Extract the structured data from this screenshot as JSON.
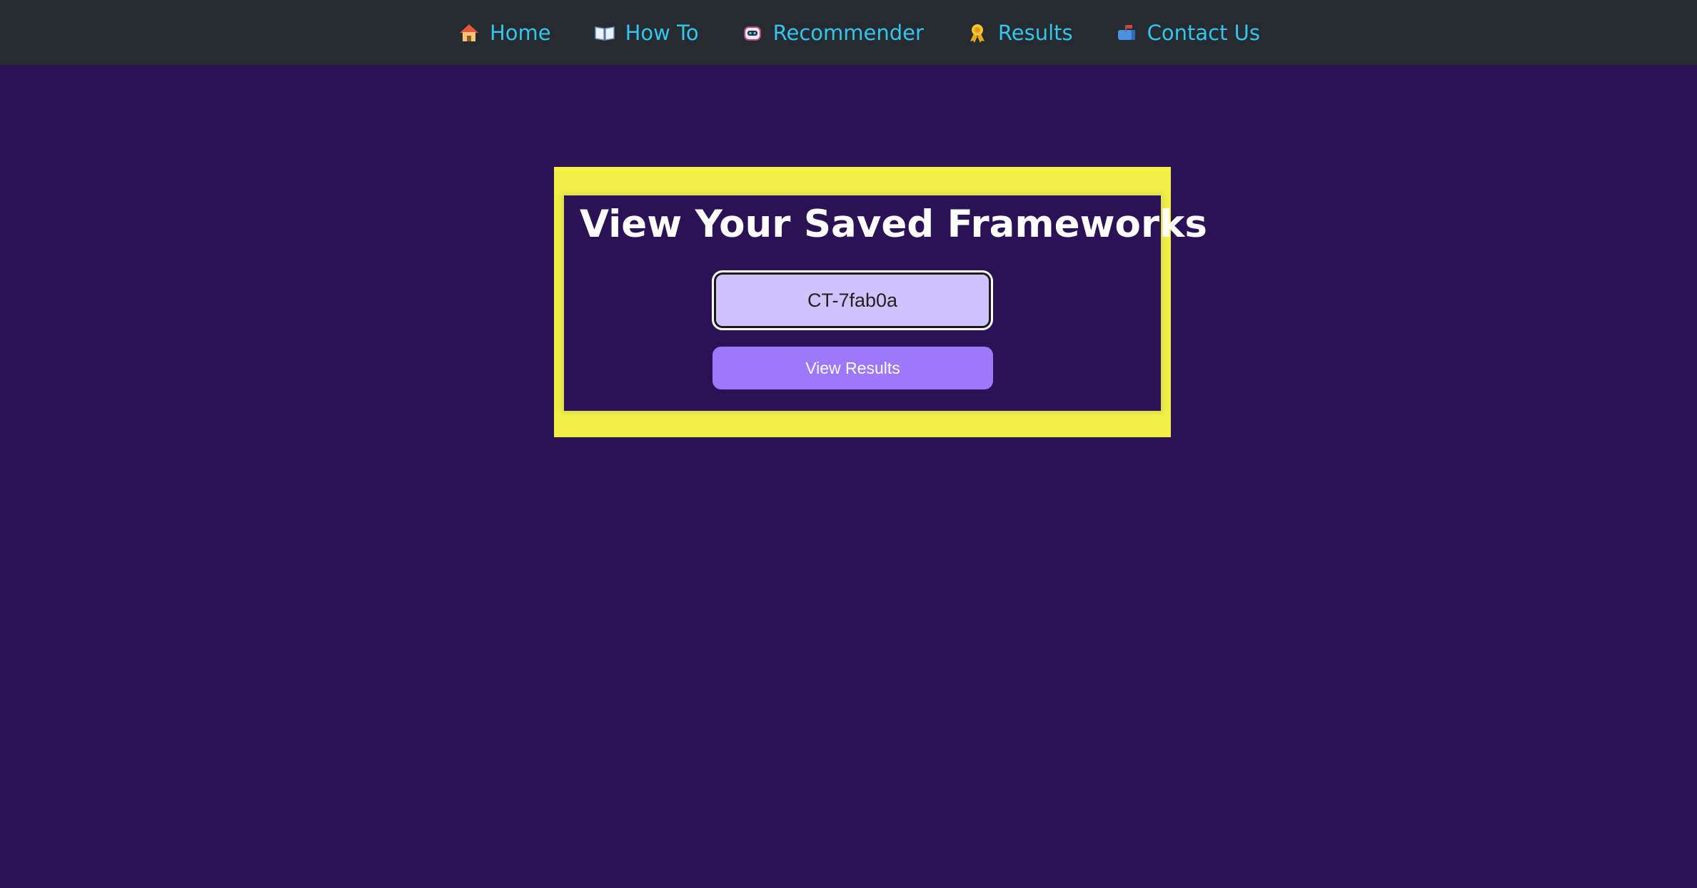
{
  "nav": {
    "items": [
      {
        "label": "Home",
        "icon": "house-icon"
      },
      {
        "label": "How To",
        "icon": "open-book-icon"
      },
      {
        "label": "Recommender",
        "icon": "robot-icon"
      },
      {
        "label": "Results",
        "icon": "ribbon-icon"
      },
      {
        "label": "Contact Us",
        "icon": "mailbox-icon"
      }
    ]
  },
  "card": {
    "title": "View Your Saved Frameworks",
    "input_value": "CT-7fab0a",
    "button_label": "View Results"
  },
  "colors": {
    "nav_background": "#262a31",
    "nav_text": "#34c6ea",
    "page_background": "#2b1257",
    "frame": "#f2f047",
    "input_background": "#cfc2fd",
    "button_background": "#9d78fa"
  }
}
